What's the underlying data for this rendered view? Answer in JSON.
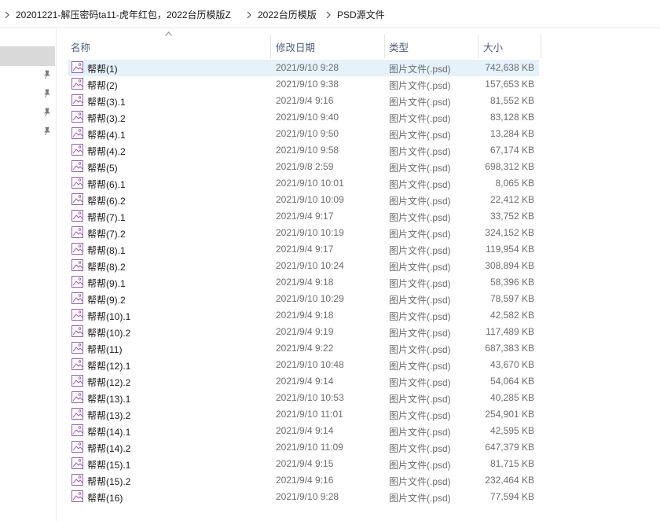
{
  "breadcrumb": [
    "20201221-解压密码ta11-虎年红包，2022台历模版Z",
    "2022台历模版",
    "PSD源文件"
  ],
  "columns": {
    "name": "名称",
    "date": "修改日期",
    "type": "类型",
    "size": "大小"
  },
  "icons": {
    "file": "image-file-icon",
    "pin": "pin-icon",
    "chevron": "chevron-right-icon",
    "sort": "sort-ascending-icon"
  },
  "colors": {
    "selected_row": "#e5f1fb",
    "nav_selected": "#d9d9d9",
    "header_text": "#4c607a",
    "file_icon": "#9b59b6"
  },
  "files": [
    {
      "name": "帮帮(1)",
      "date": "2021/9/10 9:28",
      "type": "图片文件(.psd)",
      "size": "742,638 KB"
    },
    {
      "name": "帮帮(2)",
      "date": "2021/9/10 9:38",
      "type": "图片文件(.psd)",
      "size": "157,653 KB"
    },
    {
      "name": "帮帮(3).1",
      "date": "2021/9/4 9:16",
      "type": "图片文件(.psd)",
      "size": "81,552 KB"
    },
    {
      "name": "帮帮(3).2",
      "date": "2021/9/10 9:40",
      "type": "图片文件(.psd)",
      "size": "83,128 KB"
    },
    {
      "name": "帮帮(4).1",
      "date": "2021/9/10 9:50",
      "type": "图片文件(.psd)",
      "size": "13,284 KB"
    },
    {
      "name": "帮帮(4).2",
      "date": "2021/9/10 9:58",
      "type": "图片文件(.psd)",
      "size": "67,174 KB"
    },
    {
      "name": "帮帮(5)",
      "date": "2021/9/8 2:59",
      "type": "图片文件(.psd)",
      "size": "698,312 KB"
    },
    {
      "name": "帮帮(6).1",
      "date": "2021/9/10 10:01",
      "type": "图片文件(.psd)",
      "size": "8,065 KB"
    },
    {
      "name": "帮帮(6).2",
      "date": "2021/9/10 10:09",
      "type": "图片文件(.psd)",
      "size": "22,412 KB"
    },
    {
      "name": "帮帮(7).1",
      "date": "2021/9/4 9:17",
      "type": "图片文件(.psd)",
      "size": "33,752 KB"
    },
    {
      "name": "帮帮(7).2",
      "date": "2021/9/10 10:19",
      "type": "图片文件(.psd)",
      "size": "324,152 KB"
    },
    {
      "name": "帮帮(8).1",
      "date": "2021/9/4 9:17",
      "type": "图片文件(.psd)",
      "size": "119,954 KB"
    },
    {
      "name": "帮帮(8).2",
      "date": "2021/9/10 10:24",
      "type": "图片文件(.psd)",
      "size": "308,894 KB"
    },
    {
      "name": "帮帮(9).1",
      "date": "2021/9/4 9:18",
      "type": "图片文件(.psd)",
      "size": "58,396 KB"
    },
    {
      "name": "帮帮(9).2",
      "date": "2021/9/10 10:29",
      "type": "图片文件(.psd)",
      "size": "78,597 KB"
    },
    {
      "name": "帮帮(10).1",
      "date": "2021/9/4 9:18",
      "type": "图片文件(.psd)",
      "size": "42,582 KB"
    },
    {
      "name": "帮帮(10).2",
      "date": "2021/9/4 9:19",
      "type": "图片文件(.psd)",
      "size": "117,489 KB"
    },
    {
      "name": "帮帮(11)",
      "date": "2021/9/4 9:22",
      "type": "图片文件(.psd)",
      "size": "687,383 KB"
    },
    {
      "name": "帮帮(12).1",
      "date": "2021/9/10 10:48",
      "type": "图片文件(.psd)",
      "size": "43,670 KB"
    },
    {
      "name": "帮帮(12).2",
      "date": "2021/9/4 9:14",
      "type": "图片文件(.psd)",
      "size": "54,064 KB"
    },
    {
      "name": "帮帮(13).1",
      "date": "2021/9/10 10:53",
      "type": "图片文件(.psd)",
      "size": "40,285 KB"
    },
    {
      "name": "帮帮(13).2",
      "date": "2021/9/10 11:01",
      "type": "图片文件(.psd)",
      "size": "254,901 KB"
    },
    {
      "name": "帮帮(14).1",
      "date": "2021/9/4 9:14",
      "type": "图片文件(.psd)",
      "size": "42,595 KB"
    },
    {
      "name": "帮帮(14).2",
      "date": "2021/9/10 11:09",
      "type": "图片文件(.psd)",
      "size": "647,379 KB"
    },
    {
      "name": "帮帮(15).1",
      "date": "2021/9/4 9:15",
      "type": "图片文件(.psd)",
      "size": "81,715 KB"
    },
    {
      "name": "帮帮(15).2",
      "date": "2021/9/4 9:16",
      "type": "图片文件(.psd)",
      "size": "232,464 KB"
    },
    {
      "name": "帮帮(16)",
      "date": "2021/9/10 9:28",
      "type": "图片文件(.psd)",
      "size": "77,594 KB"
    }
  ]
}
